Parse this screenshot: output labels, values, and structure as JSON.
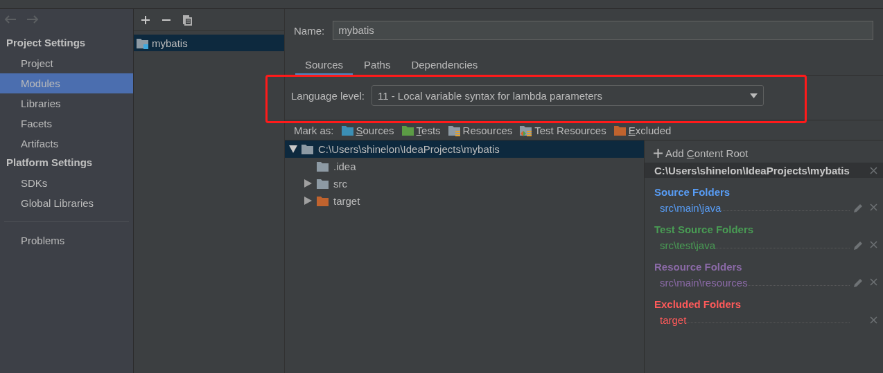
{
  "sidebar": {
    "sections": [
      {
        "title": "Project Settings",
        "items": [
          {
            "label": "Project",
            "selected": false
          },
          {
            "label": "Modules",
            "selected": true
          },
          {
            "label": "Libraries",
            "selected": false
          },
          {
            "label": "Facets",
            "selected": false
          },
          {
            "label": "Artifacts",
            "selected": false
          }
        ]
      },
      {
        "title": "Platform Settings",
        "items": [
          {
            "label": "SDKs",
            "selected": false
          },
          {
            "label": "Global Libraries",
            "selected": false
          }
        ]
      }
    ],
    "extra_items": [
      {
        "label": "Problems",
        "selected": false
      }
    ]
  },
  "module_list": {
    "items": [
      {
        "label": "mybatis",
        "selected": true
      }
    ]
  },
  "name_field": {
    "label": "Name:",
    "value": "mybatis"
  },
  "tabs": [
    {
      "label": "Sources",
      "selected": true
    },
    {
      "label": "Paths",
      "selected": false
    },
    {
      "label": "Dependencies",
      "selected": false
    }
  ],
  "language_level": {
    "label": "Language level:",
    "value": "11 - Local variable syntax for lambda parameters"
  },
  "annotations": [
    {
      "kind": "rectangle",
      "color": "#ff1a1a"
    }
  ],
  "mark_as": {
    "label": "Mark as:",
    "options": [
      {
        "kind": "sources",
        "key": "S",
        "after": "ources"
      },
      {
        "kind": "tests",
        "key": "T",
        "after": "ests"
      },
      {
        "kind": "resources",
        "before": "Resources"
      },
      {
        "kind": "test-resources",
        "before": "Test Resources"
      },
      {
        "kind": "excluded",
        "key": "E",
        "after": "xcluded"
      }
    ]
  },
  "tree": [
    {
      "label": "C:\\Users\\shinelon\\IdeaProjects\\mybatis",
      "kind": "plain",
      "leaf": false,
      "expanded": true,
      "selected": true,
      "children": [
        {
          "label": ".idea",
          "kind": "plain",
          "leaf": true,
          "selected": false
        },
        {
          "label": "src",
          "kind": "plain",
          "leaf": false,
          "expanded": false,
          "selected": false
        },
        {
          "label": "target",
          "kind": "excluded",
          "leaf": false,
          "expanded": false,
          "selected": false
        }
      ]
    }
  ],
  "content_root": {
    "add_button": {
      "before": "Add ",
      "key": "C",
      "after": "ontent Root"
    },
    "path": "C:\\Users\\shinelon\\IdeaProjects\\mybatis",
    "groups": [
      {
        "title": "Source Folders",
        "color": "#589df6",
        "entries": [
          {
            "path": "src\\main\\java",
            "editable": true
          }
        ]
      },
      {
        "title": "Test Source Folders",
        "color": "#499c54",
        "entries": [
          {
            "path": "src\\test\\java",
            "editable": true
          }
        ]
      },
      {
        "title": "Resource Folders",
        "color": "#8b6aa7",
        "entries": [
          {
            "path": "src\\main\\resources",
            "editable": true
          }
        ]
      },
      {
        "title": "Excluded Folders",
        "color": "#ff5a5a",
        "entries": [
          {
            "path": "target",
            "editable": false
          }
        ]
      }
    ]
  }
}
